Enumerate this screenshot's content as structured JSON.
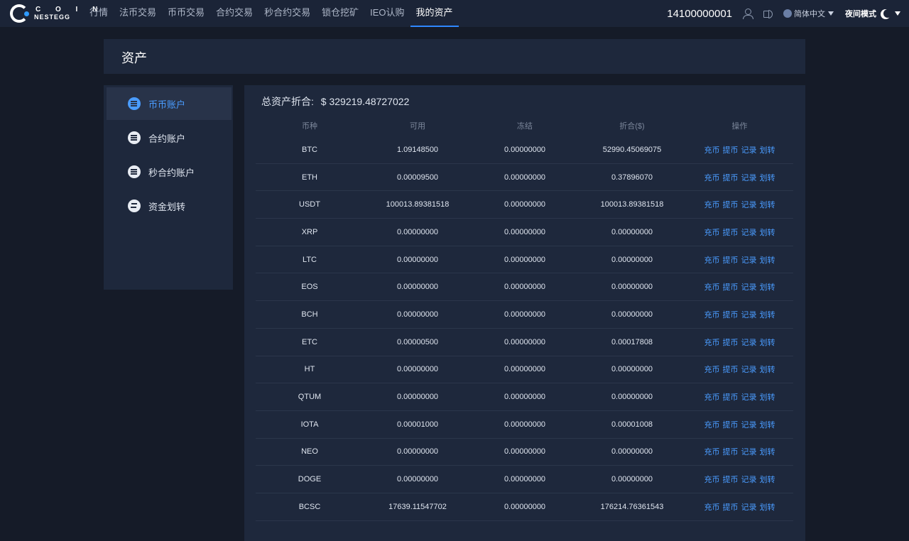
{
  "logo": {
    "top": "C O I N",
    "bottom": "NESTEGG"
  },
  "nav": [
    {
      "label": "行情",
      "active": false
    },
    {
      "label": "法币交易",
      "active": false
    },
    {
      "label": "币币交易",
      "active": false
    },
    {
      "label": "合约交易",
      "active": false
    },
    {
      "label": "秒合约交易",
      "active": false
    },
    {
      "label": "锁仓挖矿",
      "active": false
    },
    {
      "label": "IEO认购",
      "active": false
    },
    {
      "label": "我的资产",
      "active": true
    }
  ],
  "topbar": {
    "phone": "14100000001",
    "language": "简体中文",
    "night_mode": "夜间模式"
  },
  "page_title": "资产",
  "sidebar": [
    {
      "label": "币币账户",
      "icon": "exchange-account-icon",
      "active": true
    },
    {
      "label": "合约账户",
      "icon": "contract-account-icon",
      "active": false
    },
    {
      "label": "秒合约账户",
      "icon": "second-contract-account-icon",
      "active": false
    },
    {
      "label": "资金划转",
      "icon": "transfer-icon",
      "active": false
    }
  ],
  "total": {
    "label": "总资产折合:",
    "value": "$ 329219.48727022"
  },
  "table": {
    "headers": [
      "币种",
      "可用",
      "冻结",
      "折合($)",
      "操作"
    ],
    "actions": [
      "充币",
      "提币",
      "记录",
      "划转"
    ],
    "rows": [
      {
        "coin": "BTC",
        "available": "1.09148500",
        "frozen": "0.00000000",
        "usd": "52990.45069075"
      },
      {
        "coin": "ETH",
        "available": "0.00009500",
        "frozen": "0.00000000",
        "usd": "0.37896070"
      },
      {
        "coin": "USDT",
        "available": "100013.89381518",
        "frozen": "0.00000000",
        "usd": "100013.89381518"
      },
      {
        "coin": "XRP",
        "available": "0.00000000",
        "frozen": "0.00000000",
        "usd": "0.00000000"
      },
      {
        "coin": "LTC",
        "available": "0.00000000",
        "frozen": "0.00000000",
        "usd": "0.00000000"
      },
      {
        "coin": "EOS",
        "available": "0.00000000",
        "frozen": "0.00000000",
        "usd": "0.00000000"
      },
      {
        "coin": "BCH",
        "available": "0.00000000",
        "frozen": "0.00000000",
        "usd": "0.00000000"
      },
      {
        "coin": "ETC",
        "available": "0.00000500",
        "frozen": "0.00000000",
        "usd": "0.00017808"
      },
      {
        "coin": "HT",
        "available": "0.00000000",
        "frozen": "0.00000000",
        "usd": "0.00000000"
      },
      {
        "coin": "QTUM",
        "available": "0.00000000",
        "frozen": "0.00000000",
        "usd": "0.00000000"
      },
      {
        "coin": "IOTA",
        "available": "0.00001000",
        "frozen": "0.00000000",
        "usd": "0.00001008"
      },
      {
        "coin": "NEO",
        "available": "0.00000000",
        "frozen": "0.00000000",
        "usd": "0.00000000"
      },
      {
        "coin": "DOGE",
        "available": "0.00000000",
        "frozen": "0.00000000",
        "usd": "0.00000000"
      },
      {
        "coin": "BCSC",
        "available": "17639.11547702",
        "frozen": "0.00000000",
        "usd": "176214.76361543"
      }
    ]
  }
}
